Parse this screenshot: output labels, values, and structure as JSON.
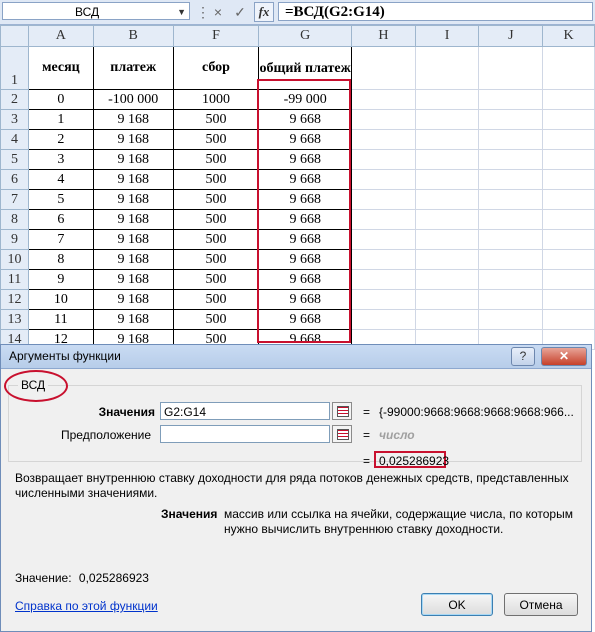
{
  "formula_bar": {
    "name_box": "ВСД",
    "cancel_icon": "×",
    "enter_icon": "✓",
    "fx_label": "fx",
    "formula": "=ВСД(G2:G14)"
  },
  "sheet": {
    "columns": [
      "A",
      "B",
      "F",
      "G",
      "H",
      "I",
      "J",
      "K"
    ],
    "header_row": {
      "num": "1",
      "cells": [
        "месяц",
        "платеж",
        "сбор",
        "общий платеж"
      ]
    },
    "rows": [
      {
        "num": "2",
        "a": "0",
        "b": "-100 000",
        "f": "1000",
        "g": "-99 000"
      },
      {
        "num": "3",
        "a": "1",
        "b": "9 168",
        "f": "500",
        "g": "9 668"
      },
      {
        "num": "4",
        "a": "2",
        "b": "9 168",
        "f": "500",
        "g": "9 668"
      },
      {
        "num": "5",
        "a": "3",
        "b": "9 168",
        "f": "500",
        "g": "9 668"
      },
      {
        "num": "6",
        "a": "4",
        "b": "9 168",
        "f": "500",
        "g": "9 668"
      },
      {
        "num": "7",
        "a": "5",
        "b": "9 168",
        "f": "500",
        "g": "9 668"
      },
      {
        "num": "8",
        "a": "6",
        "b": "9 168",
        "f": "500",
        "g": "9 668"
      },
      {
        "num": "9",
        "a": "7",
        "b": "9 168",
        "f": "500",
        "g": "9 668"
      },
      {
        "num": "10",
        "a": "8",
        "b": "9 168",
        "f": "500",
        "g": "9 668"
      },
      {
        "num": "11",
        "a": "9",
        "b": "9 168",
        "f": "500",
        "g": "9 668"
      },
      {
        "num": "12",
        "a": "10",
        "b": "9 168",
        "f": "500",
        "g": "9 668"
      },
      {
        "num": "13",
        "a": "11",
        "b": "9 168",
        "f": "500",
        "g": "9 668"
      },
      {
        "num": "14",
        "a": "12",
        "b": "9 168",
        "f": "500",
        "g": "9 668"
      }
    ]
  },
  "dialog": {
    "title": "Аргументы функции",
    "help_btn": "?",
    "close_btn": "✕",
    "function_name": "ВСД",
    "arg1_label": "Значения",
    "arg1_value": "G2:G14",
    "arg1_result": "{-99000:9668:9668:9668:9668:966...",
    "arg2_label": "Предположение",
    "arg2_value": "",
    "arg2_result": "число",
    "equals": "=",
    "result": "0,025286923",
    "description": "Возвращает внутреннюю ставку доходности для ряда потоков денежных средств, представленных численными значениями.",
    "param_name": "Значения",
    "param_desc": "массив или ссылка на ячейки, содержащие числа, по которым нужно вычислить внутреннюю ставку доходности.",
    "value_label": "Значение:",
    "value": "0,025286923",
    "help_link": "Справка по этой функции",
    "ok": "OK",
    "cancel": "Отмена"
  }
}
